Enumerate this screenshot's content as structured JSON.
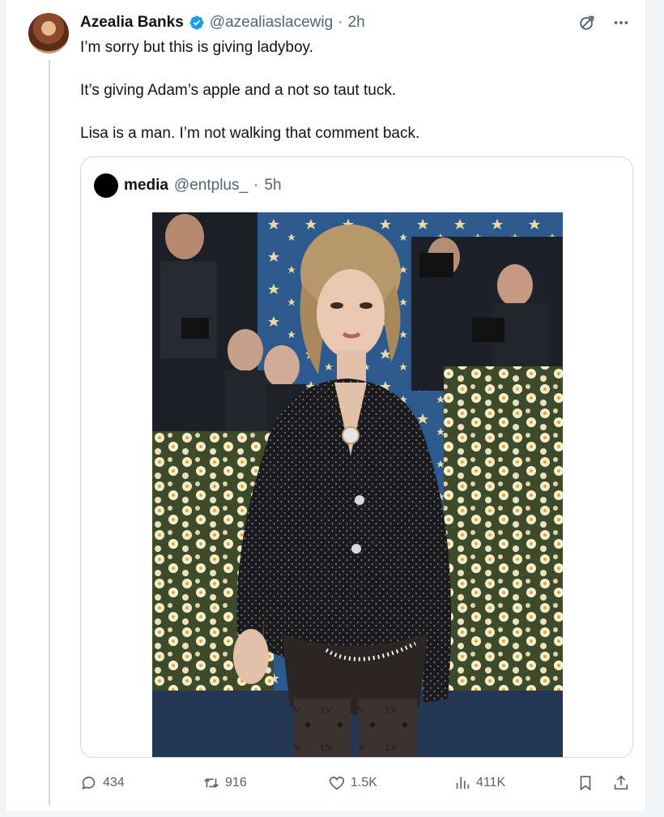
{
  "tweet": {
    "author_name": "Azealia Banks",
    "handle": "@azealiaslacewig",
    "separator": "·",
    "time": "2h",
    "lines": [
      "I’m sorry but this is giving ladyboy.",
      "It’s giving Adam’s apple and a not so taut tuck.",
      "Lisa is a man. I’m not walking that comment back."
    ]
  },
  "quote": {
    "author_name": "media",
    "handle": "@entplus_",
    "separator": "·",
    "time": "5h"
  },
  "stats": {
    "replies": "434",
    "retweets": "916",
    "likes": "1.5K",
    "views": "411K"
  },
  "icons": {
    "verified": "verified-badge-icon",
    "grok": "grok-icon",
    "more": "more-icon",
    "reply": "reply-icon",
    "retweet": "retweet-icon",
    "like": "heart-icon",
    "views": "views-icon",
    "bookmark": "bookmark-icon",
    "share": "share-icon"
  },
  "colors": {
    "verified_blue": "#1d9bf0",
    "text_primary": "#0f1419",
    "text_secondary": "#536471",
    "border": "#cfd9de"
  }
}
